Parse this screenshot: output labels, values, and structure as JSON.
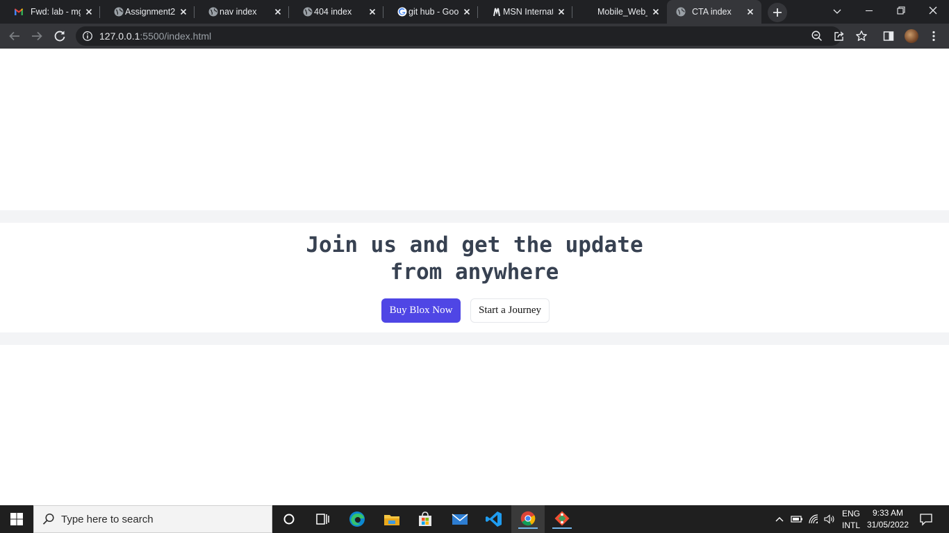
{
  "browser": {
    "tabs": [
      {
        "title": "Fwd: lab - mg",
        "icon": "gmail-icon"
      },
      {
        "title": "Assignment2",
        "icon": "globe-icon"
      },
      {
        "title": "nav index",
        "icon": "globe-icon"
      },
      {
        "title": "404 index",
        "icon": "globe-icon"
      },
      {
        "title": "git hub - Goo",
        "icon": "google-icon"
      },
      {
        "title": "MSN Internat",
        "icon": "msn-icon"
      },
      {
        "title": "Mobile_Web_",
        "icon": "none"
      },
      {
        "title": "CTA index",
        "icon": "globe-icon",
        "active": true
      }
    ],
    "address_host": "127.0.0.1",
    "address_rest": ":5500/index.html"
  },
  "page": {
    "cta_title_line1": "Join us and get the update",
    "cta_title_line2": "from anywhere",
    "primary_button": "Buy Blox Now",
    "secondary_button": "Start a Journey",
    "colors": {
      "primary": "#4f46e5",
      "band": "#f3f4f6",
      "title": "#374151"
    }
  },
  "taskbar": {
    "search_placeholder": "Type here to search",
    "apps": [
      "cortana-icon",
      "task-view-icon",
      "edge-icon",
      "file-explorer-icon",
      "store-icon",
      "mail-icon",
      "vscode-icon",
      "chrome-icon",
      "git-icon"
    ],
    "lang_top": "ENG",
    "lang_bottom": "INTL",
    "time": "9:33 AM",
    "date": "31/05/2022"
  }
}
